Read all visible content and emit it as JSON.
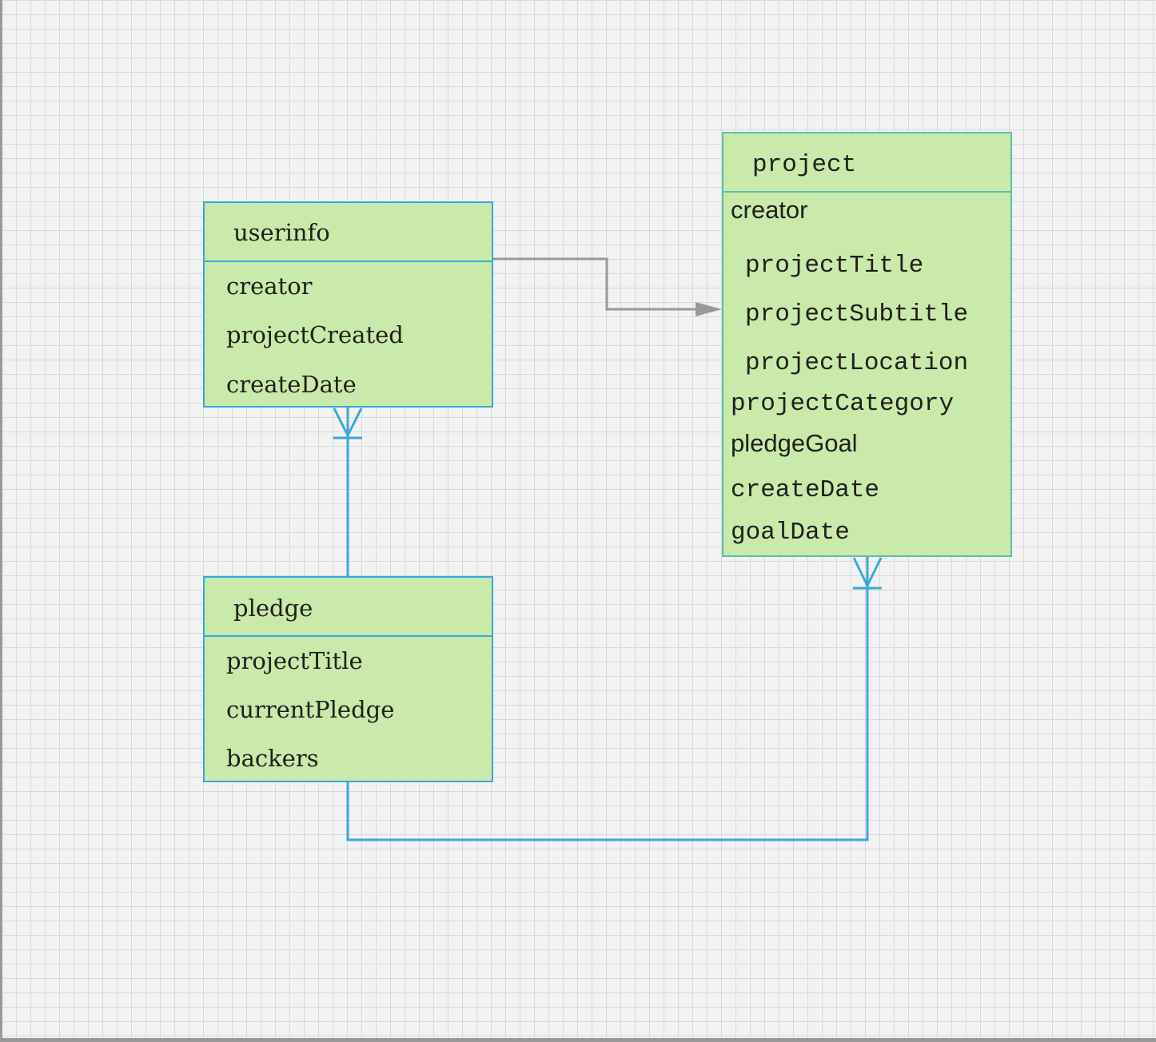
{
  "entities": {
    "userinfo": {
      "title": "userinfo",
      "fields": [
        "creator",
        "projectCreated",
        "createDate"
      ]
    },
    "pledge": {
      "title": "pledge",
      "fields": [
        "projectTitle",
        "currentPledge",
        "backers"
      ]
    },
    "project": {
      "title": "project",
      "fields": [
        "creator",
        "projectTitle",
        "projectSubtitle",
        "projectLocation",
        "projectCategory",
        "pledgeGoal",
        "createDate",
        "goalDate"
      ]
    }
  },
  "colors": {
    "entity_fill": "#c9eaaa",
    "entity_border": "#3aa7dc",
    "project_border": "#5cbfaa",
    "relationship_line": "#3aa7dc",
    "arrow_line": "#999999",
    "canvas_background": "#f2f2f2",
    "grid_line": "#d9d9d9"
  },
  "relationships": [
    {
      "from": "userinfo",
      "to": "project",
      "style": "arrow"
    },
    {
      "from": "pledge",
      "to": "userinfo",
      "style": "one-to-many"
    },
    {
      "from": "pledge",
      "to": "project",
      "style": "one-to-many"
    }
  ]
}
